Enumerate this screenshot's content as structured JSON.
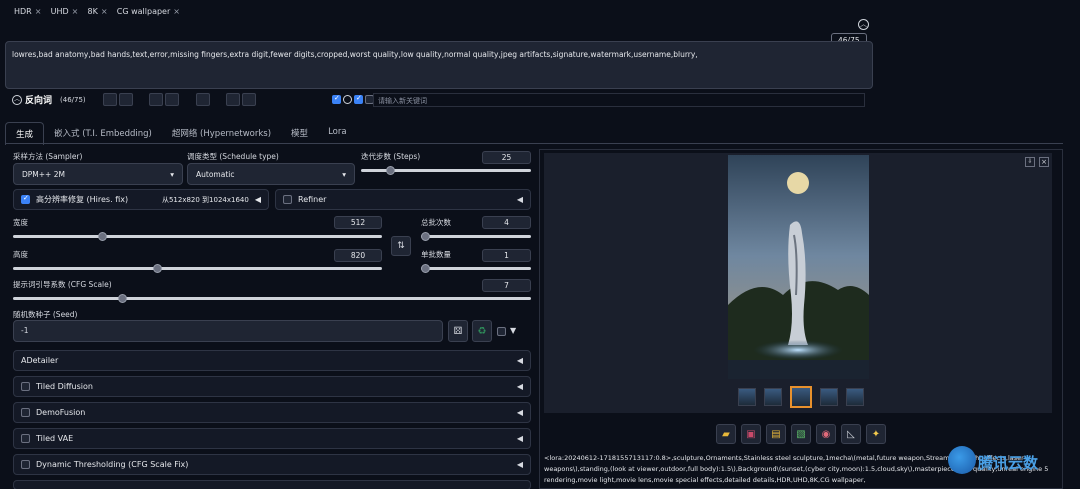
{
  "top_tags": [
    {
      "label": "HDR"
    },
    {
      "label": "UHD"
    },
    {
      "label": "8K"
    },
    {
      "label": "CG wallpaper"
    }
  ],
  "positive_counter": "46/75",
  "negative_prompt": "lowres,bad anatomy,bad hands,text,error,missing fingers,extra digit,fewer digits,cropped,worst quality,low quality,normal quality,jpeg artifacts,signature,watermark,username,blurry,",
  "negative_header": {
    "label": "反向词",
    "counter": "(46/75)"
  },
  "keyword_placeholder": "请输入新关键词",
  "tabs": [
    {
      "label": "生成"
    },
    {
      "label": "嵌入式 (T.I. Embedding)"
    },
    {
      "label": "超网络 (Hypernetworks)"
    },
    {
      "label": "模型"
    },
    {
      "label": "Lora"
    }
  ],
  "sampler": {
    "label": "采样方法 (Sampler)",
    "value": "DPM++ 2M"
  },
  "schedule": {
    "label": "调度类型 (Schedule type)",
    "value": "Automatic"
  },
  "steps": {
    "label": "迭代步数 (Steps)",
    "value": "25",
    "fraction": 0.17
  },
  "hires": {
    "label": "高分辨率修复 (Hires. fix)",
    "info": "从512x820 到1024x1640"
  },
  "refiner": {
    "label": "Refiner"
  },
  "width": {
    "label": "宽度",
    "value": "512",
    "fraction": 0.24
  },
  "height": {
    "label": "高度",
    "value": "820",
    "fraction": 0.39
  },
  "batch_count": {
    "label": "总批次数",
    "value": "4",
    "fraction": 0.03
  },
  "batch_size": {
    "label": "单批数量",
    "value": "1",
    "fraction": 0.0
  },
  "cfg": {
    "label": "提示词引导系数 (CFG Scale)",
    "value": "7",
    "fraction": 0.21
  },
  "seed": {
    "label": "随机数种子 (Seed)",
    "value": "-1"
  },
  "accordions": [
    {
      "label": "ADetailer",
      "checkbox": false
    },
    {
      "label": "Tiled Diffusion",
      "checkbox": true
    },
    {
      "label": "DemoFusion",
      "checkbox": true
    },
    {
      "label": "Tiled VAE",
      "checkbox": true
    },
    {
      "label": "Dynamic Thresholding (CFG Scale Fix)",
      "checkbox": true
    }
  ],
  "output_caption": "<lora:20240612-1718155713117:0.8>,sculpture,Ornaments,Stainless steel sculpture,1mecha\\(metal,future weapon,Streamlined,light effects,laser weapons\\),standing,(look at viewer,outdoor,full body):1.5\\),Background\\(sunset,(cyber city,moon):1.5,cloud,sky\\),masterpiece,best quality,unreal engine 5 rendering,movie light,movie lens,movie special effects,detailed details,HDR,UHD,8K,CG wallpaper,",
  "watermark": "腾讯云数",
  "colors": {
    "accent": "#3b82f6",
    "selected_thumb": "#e8912d",
    "green_button": "#2f8f5b"
  }
}
